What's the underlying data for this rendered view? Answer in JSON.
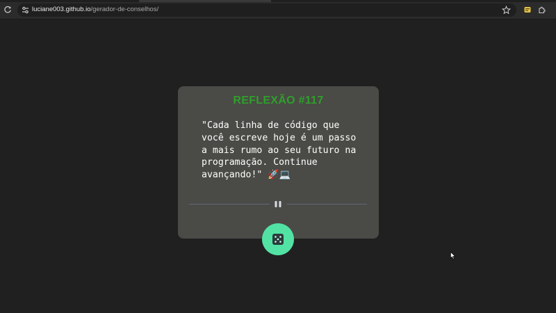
{
  "browser": {
    "url_host": "luciane003.github.io",
    "url_path": "/gerador-de-conselhos/",
    "reload_icon": "reload-icon",
    "site_info_icon": "tune-icon",
    "bookmark_icon": "star-icon",
    "extension_icon": "extension-icon",
    "extensions_menu_icon": "puzzle-icon"
  },
  "card": {
    "title": "REFLEXÃO #117",
    "advice": "\"Cada linha de código que você escreve hoje é um passo a mais rumo ao seu futuro na programação. Continue avançando!\" 🚀💻",
    "divider_icon": "pause-icon",
    "button_icon": "dice-icon"
  },
  "colors": {
    "background": "#202020",
    "card": "#4a4a46",
    "title": "#2ea02a",
    "button": "#52e3a4"
  }
}
